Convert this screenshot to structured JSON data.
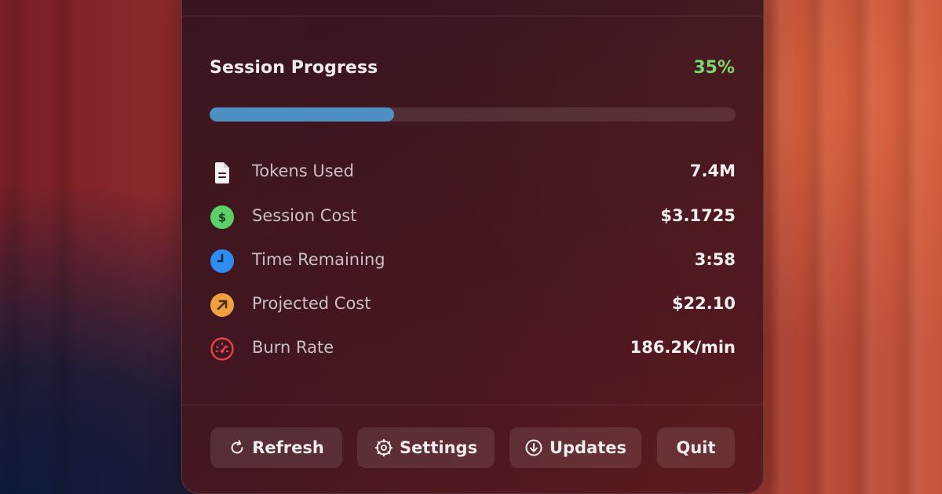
{
  "progress": {
    "title": "Session Progress",
    "percent_label": "35%",
    "fraction": 0.35,
    "fill_color": "#4e8fc4",
    "percent_color": "#7bd86a"
  },
  "stats": [
    {
      "icon": "document-icon",
      "label": "Tokens Used",
      "value": "7.4M"
    },
    {
      "icon": "dollar-icon",
      "label": "Session Cost",
      "value": "$3.1725"
    },
    {
      "icon": "clock-icon",
      "label": "Time Remaining",
      "value": "3:58"
    },
    {
      "icon": "trend-arrow-icon",
      "label": "Projected Cost",
      "value": "$22.10"
    },
    {
      "icon": "gauge-icon",
      "label": "Burn Rate",
      "value": "186.2K/min"
    }
  ],
  "colors": {
    "dollar": "#5bd16a",
    "clock": "#2f8cf0",
    "trend": "#f0a040",
    "gauge": "#e0474c"
  },
  "buttons": {
    "refresh": "Refresh",
    "settings": "Settings",
    "updates": "Updates",
    "quit": "Quit"
  }
}
